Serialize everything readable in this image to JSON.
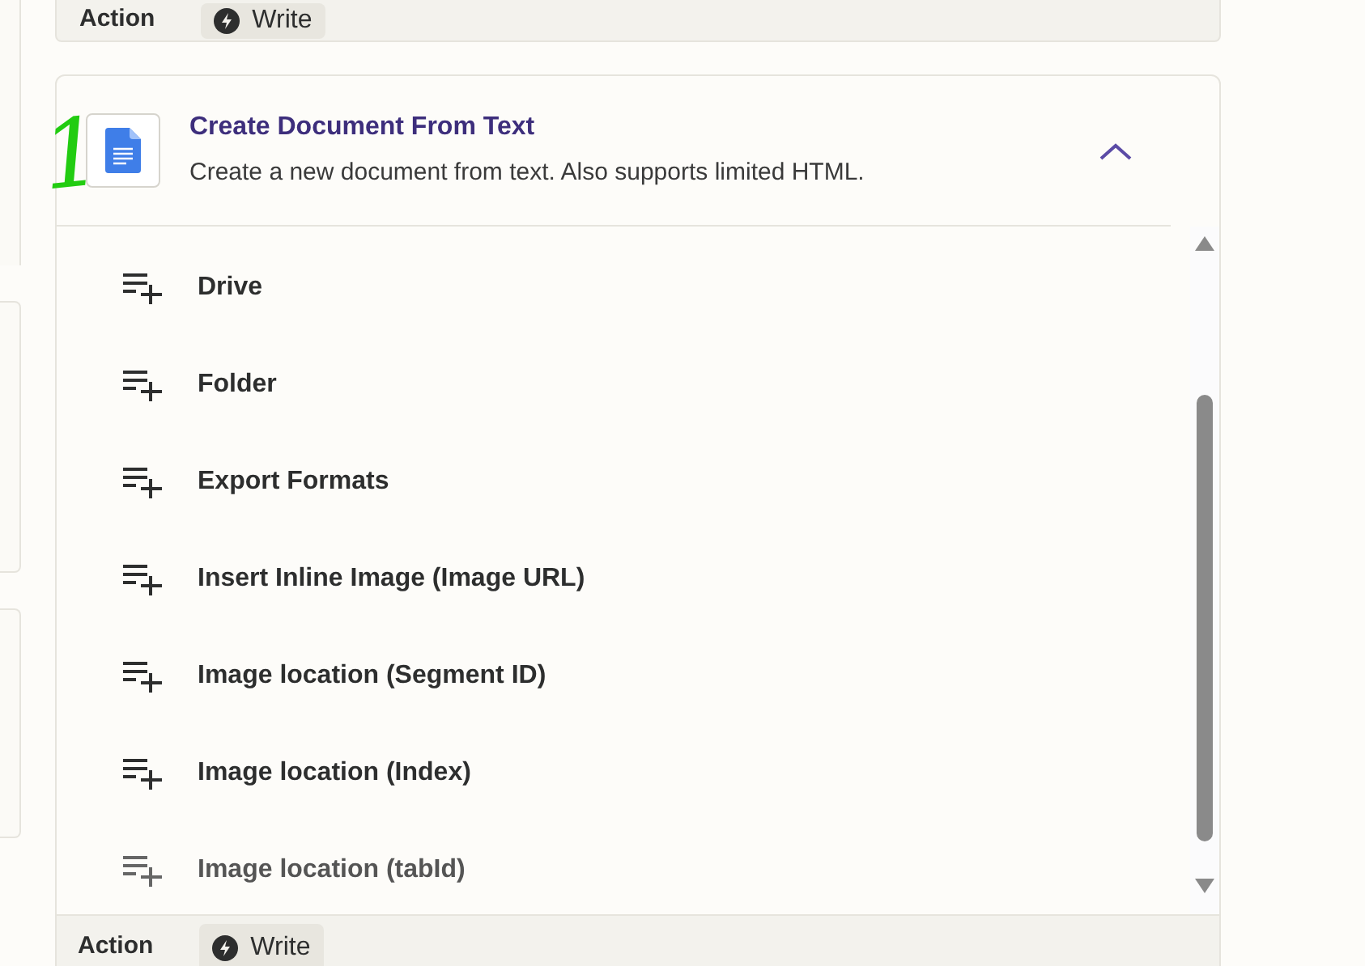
{
  "previous_card": {
    "label": "Action",
    "badge": "Write"
  },
  "annotation": "1",
  "step": {
    "title": "Create Document From Text",
    "description": "Create a new document from text. Also supports limited HTML.",
    "expanded": true
  },
  "fields": [
    {
      "label": "Drive"
    },
    {
      "label": "Folder"
    },
    {
      "label": "Export Formats"
    },
    {
      "label": "Insert Inline Image (Image URL)"
    },
    {
      "label": "Image location (Segment ID)"
    },
    {
      "label": "Image location (Index)"
    },
    {
      "label": "Image location (tabId)"
    }
  ],
  "footer": {
    "label": "Action",
    "badge": "Write"
  }
}
